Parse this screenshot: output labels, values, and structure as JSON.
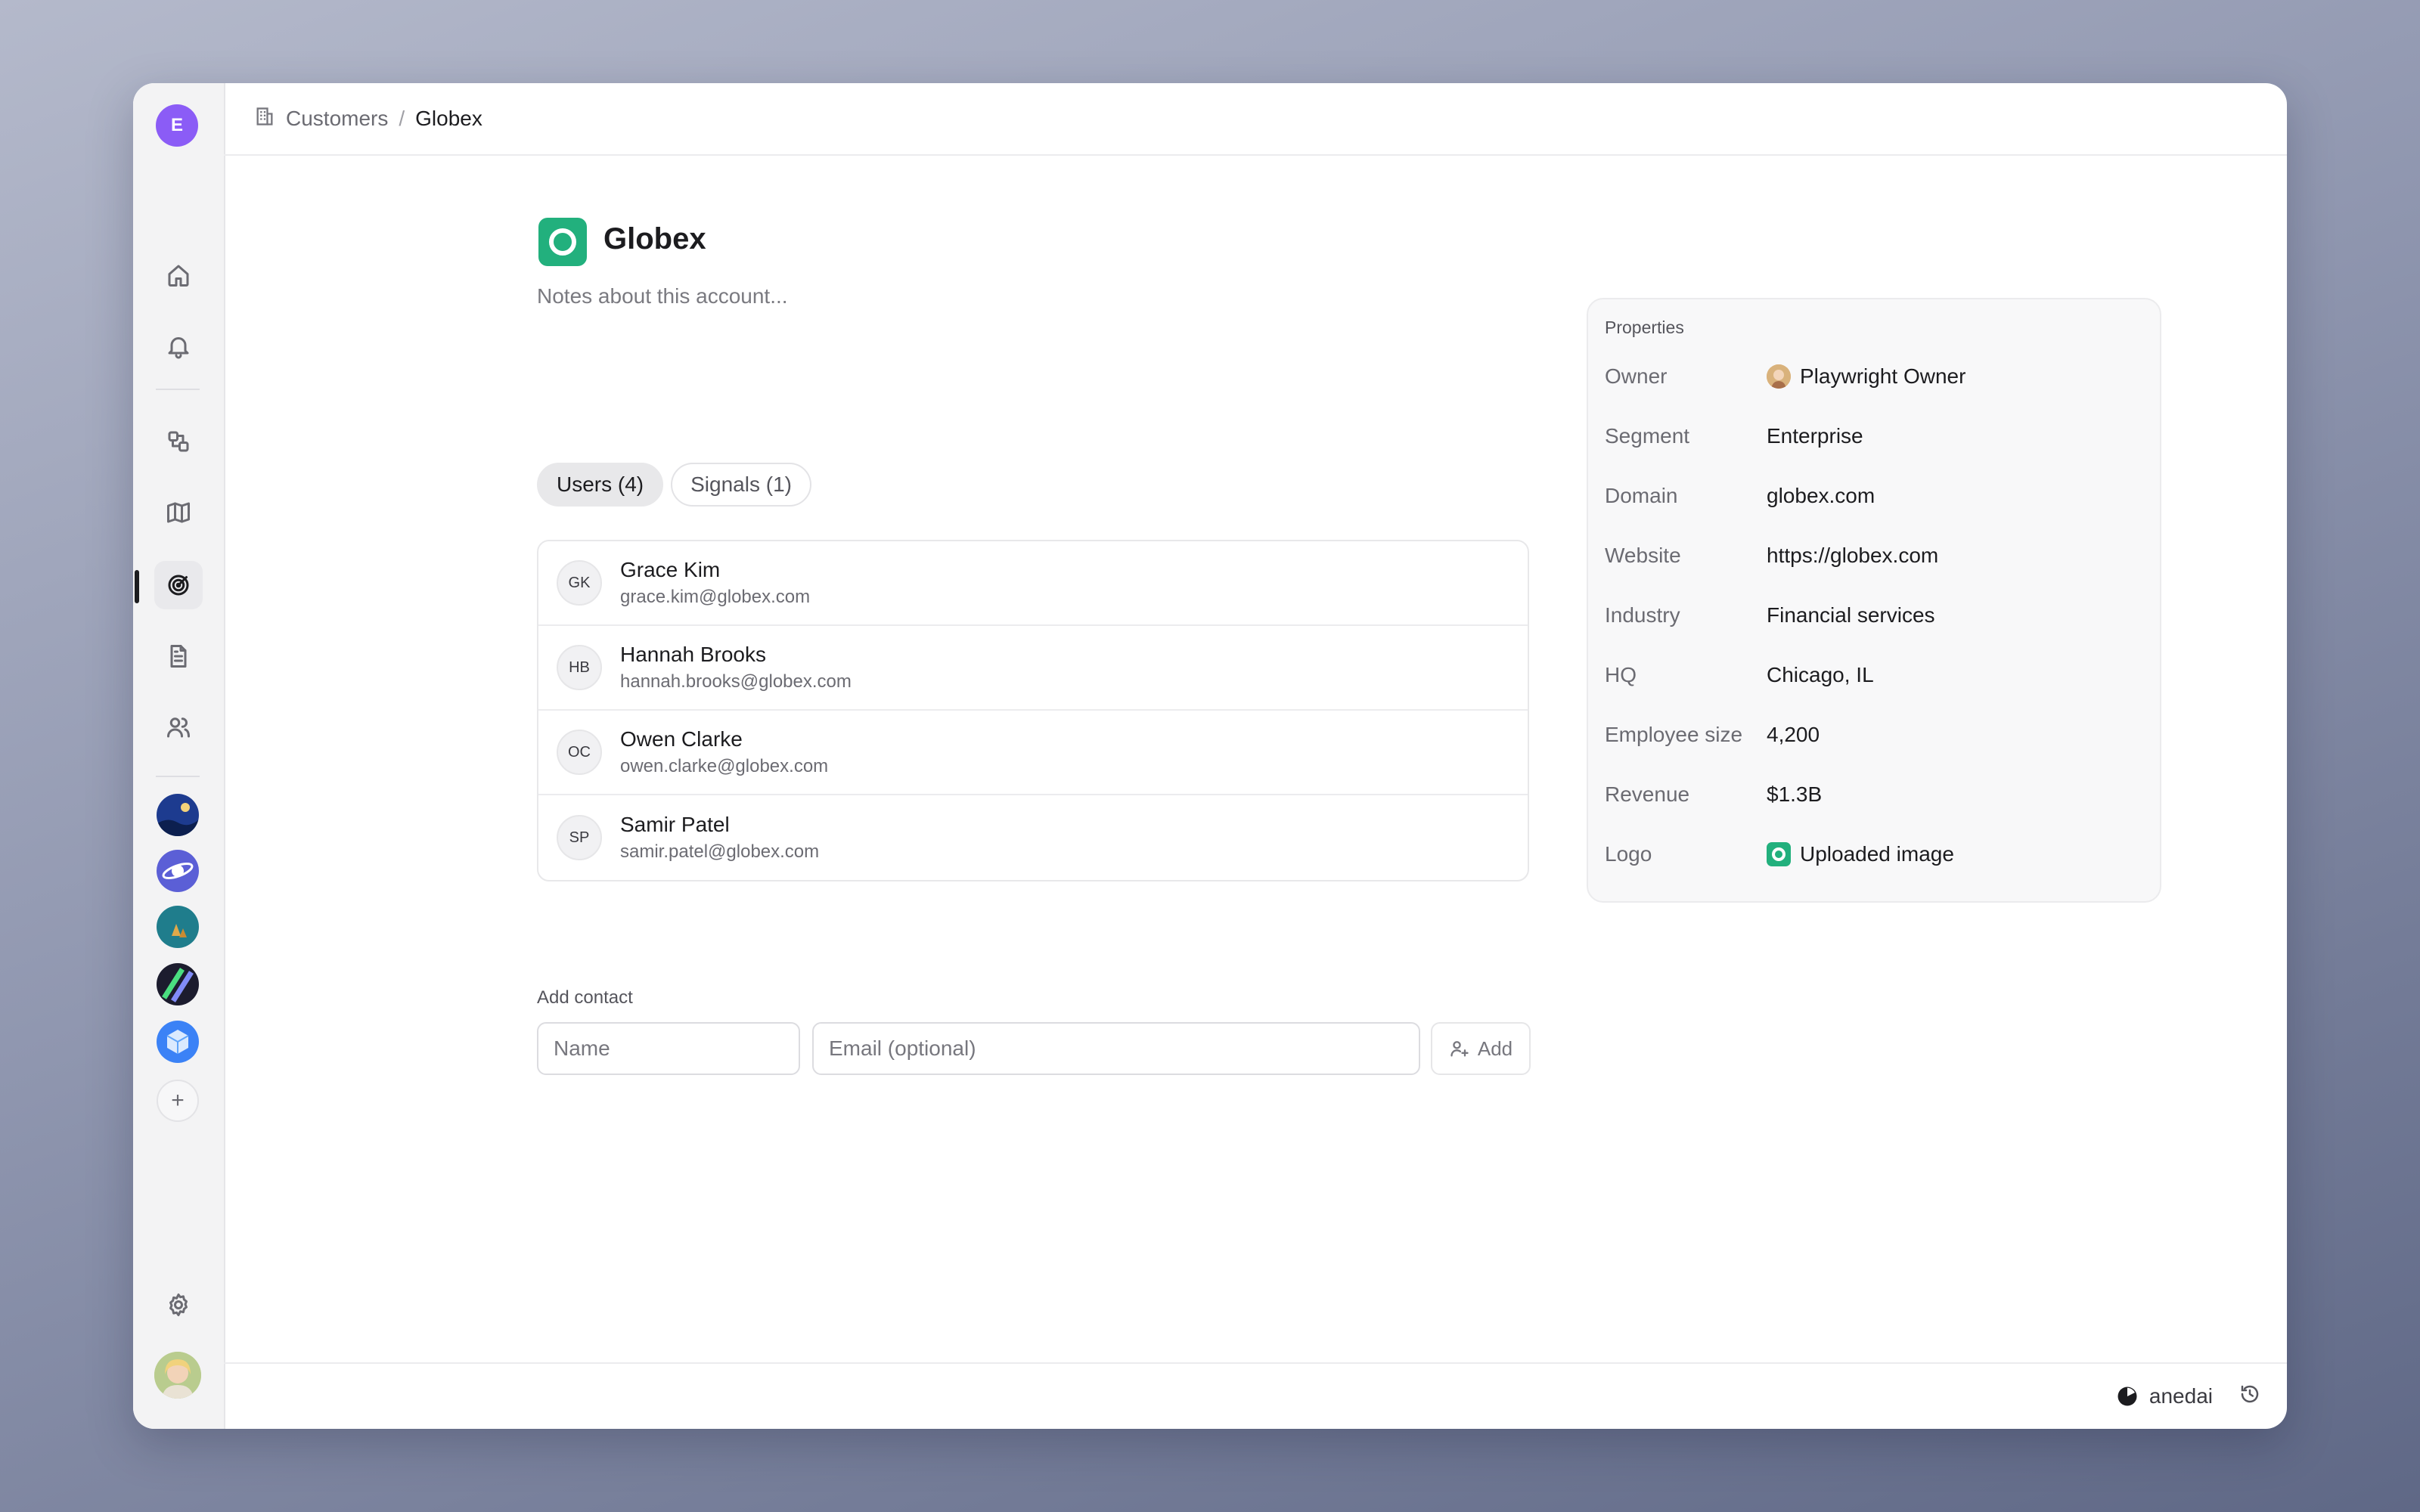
{
  "breadcrumb": {
    "parent": "Customers",
    "separator": "/",
    "current": "Globex"
  },
  "workspace": {
    "initial": "E",
    "color": "#8b5cf6"
  },
  "nav": [
    {
      "icon": "home-icon"
    },
    {
      "icon": "bell-icon"
    },
    {
      "icon": "shapes-icon"
    },
    {
      "icon": "map-icon"
    },
    {
      "icon": "target-icon",
      "active": true
    },
    {
      "icon": "document-icon"
    },
    {
      "icon": "users-icon"
    }
  ],
  "account": {
    "name": "Globex",
    "brand_color": "#22b07d",
    "notes_placeholder": "Notes about this account..."
  },
  "tabs": [
    {
      "label": "Users (4)",
      "selected": true
    },
    {
      "label": "Signals (1)",
      "selected": false
    }
  ],
  "users": [
    {
      "initials": "GK",
      "name": "Grace Kim",
      "email": "grace.kim@globex.com"
    },
    {
      "initials": "HB",
      "name": "Hannah Brooks",
      "email": "hannah.brooks@globex.com"
    },
    {
      "initials": "OC",
      "name": "Owen Clarke",
      "email": "owen.clarke@globex.com"
    },
    {
      "initials": "SP",
      "name": "Samir Patel",
      "email": "samir.patel@globex.com"
    }
  ],
  "add_contact": {
    "label": "Add contact",
    "name_placeholder": "Name",
    "email_placeholder": "Email (optional)",
    "button_label": "Add"
  },
  "properties": {
    "title": "Properties",
    "rows": [
      {
        "key": "Owner",
        "value": "Playwright Owner"
      },
      {
        "key": "Segment",
        "value": "Enterprise"
      },
      {
        "key": "Domain",
        "value": "globex.com"
      },
      {
        "key": "Website",
        "value": "https://globex.com"
      },
      {
        "key": "Industry",
        "value": "Financial services"
      },
      {
        "key": "HQ",
        "value": "Chicago, IL"
      },
      {
        "key": "Employee size",
        "value": "4,200"
      },
      {
        "key": "Revenue",
        "value": "$1.3B"
      },
      {
        "key": "Logo",
        "value": "Uploaded image"
      }
    ]
  },
  "footer": {
    "user": "anedai"
  }
}
